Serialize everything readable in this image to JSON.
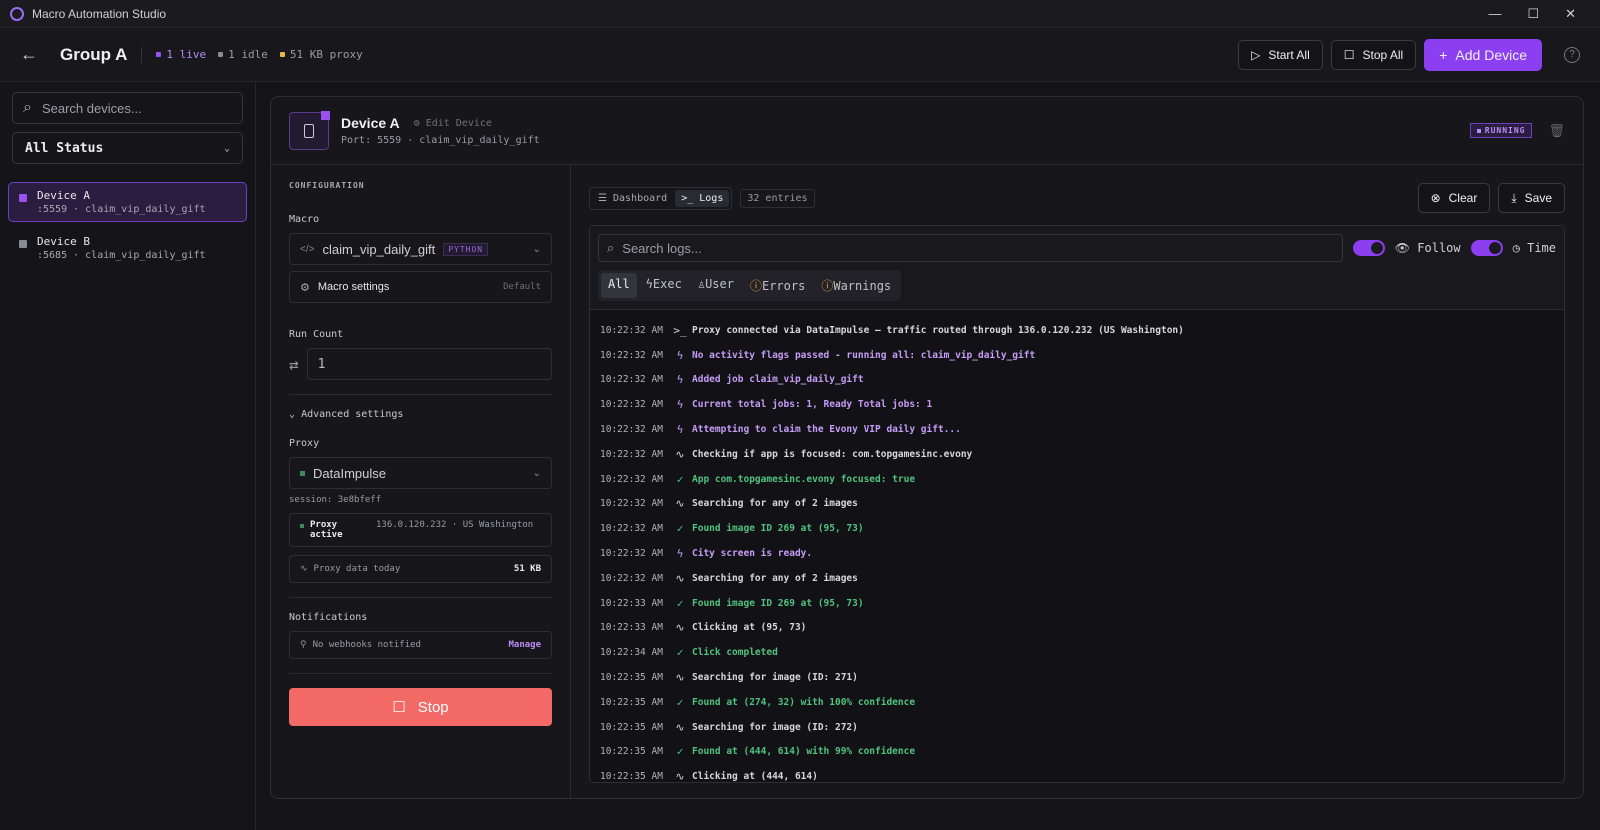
{
  "app": {
    "title": "Macro Automation Studio"
  },
  "header": {
    "group": "Group A",
    "live": "1 live",
    "idle": "1 idle",
    "proxy": "51 KB proxy",
    "start_all": "Start All",
    "stop_all": "Stop All",
    "add_device": "Add Device"
  },
  "sidebar": {
    "search_placeholder": "Search devices...",
    "status_filter": "All Status",
    "devices": [
      {
        "name": "Device A",
        "sub": ":5559 · claim_vip_daily_gift"
      },
      {
        "name": "Device B",
        "sub": ":5685 · claim_vip_daily_gift"
      }
    ]
  },
  "device": {
    "name": "Device A",
    "edit": "Edit Device",
    "sub": "Port: 5559 · claim_vip_daily_gift",
    "status": "RUNNING"
  },
  "config": {
    "section": "CONFIGURATION",
    "macro_label": "Macro",
    "macro": "claim_vip_daily_gift",
    "macro_tag": "PYTHON",
    "macro_settings": "Macro settings",
    "macro_settings_value": "Default",
    "run_count_label": "Run Count",
    "run_count": "1",
    "advanced": "Advanced settings",
    "proxy_label": "Proxy",
    "proxy": "DataImpulse",
    "session": "session: 3e8bfeff",
    "proxy_active": "Proxy active",
    "proxy_ip": "136.0.120.232 · US Washington",
    "proxy_data_label": "Proxy data today",
    "proxy_data": "51 KB",
    "notifications_label": "Notifications",
    "webhooks": "No webhooks notified",
    "manage": "Manage",
    "stop": "Stop"
  },
  "logs": {
    "tab_dashboard": "Dashboard",
    "tab_logs": "Logs",
    "entries": "32 entries",
    "clear": "Clear",
    "save": "Save",
    "search_placeholder": "Search logs...",
    "follow": "Follow",
    "time": "Time",
    "filters": [
      "All",
      "Exec",
      "User",
      "Errors",
      "Warnings"
    ],
    "rows": [
      {
        "time": "10:22:32 AM",
        "icon": "terminal-icon",
        "glyph": ">_",
        "color": "gray",
        "msg": "Proxy connected via DataImpulse — traffic routed through 136.0.120.232 (US Washington)"
      },
      {
        "time": "10:22:32 AM",
        "icon": "bolt-icon",
        "glyph": "ϟ",
        "color": "purple",
        "msg": "No activity flags passed - running all: claim_vip_daily_gift"
      },
      {
        "time": "10:22:32 AM",
        "icon": "bolt-icon",
        "glyph": "ϟ",
        "color": "purple",
        "msg": "Added job claim_vip_daily_gift"
      },
      {
        "time": "10:22:32 AM",
        "icon": "bolt-icon",
        "glyph": "ϟ",
        "color": "purple",
        "msg": "Current total jobs: 1, Ready Total jobs: 1"
      },
      {
        "time": "10:22:32 AM",
        "icon": "bolt-icon",
        "glyph": "ϟ",
        "color": "purple",
        "msg": "Attempting to claim the Evony VIP daily gift..."
      },
      {
        "time": "10:22:32 AM",
        "icon": "activity-icon",
        "glyph": "∿",
        "color": "gray",
        "msg": "Checking if app is focused: com.topgamesinc.evony"
      },
      {
        "time": "10:22:32 AM",
        "icon": "check-circle-icon",
        "glyph": "✓",
        "color": "green",
        "msg": "App com.topgamesinc.evony focused: true"
      },
      {
        "time": "10:22:32 AM",
        "icon": "activity-icon",
        "glyph": "∿",
        "color": "gray",
        "msg": "Searching for any of 2 images"
      },
      {
        "time": "10:22:32 AM",
        "icon": "check-circle-icon",
        "glyph": "✓",
        "color": "green",
        "msg": "Found image ID 269 at (95, 73)"
      },
      {
        "time": "10:22:32 AM",
        "icon": "bolt-icon",
        "glyph": "ϟ",
        "color": "purple",
        "msg": "City screen is ready."
      },
      {
        "time": "10:22:32 AM",
        "icon": "activity-icon",
        "glyph": "∿",
        "color": "gray",
        "msg": "Searching for any of 2 images"
      },
      {
        "time": "10:22:33 AM",
        "icon": "check-circle-icon",
        "glyph": "✓",
        "color": "green",
        "msg": "Found image ID 269 at (95, 73)"
      },
      {
        "time": "10:22:33 AM",
        "icon": "activity-icon",
        "glyph": "∿",
        "color": "gray",
        "msg": "Clicking at (95, 73)"
      },
      {
        "time": "10:22:34 AM",
        "icon": "check-circle-icon",
        "glyph": "✓",
        "color": "green",
        "msg": "Click completed"
      },
      {
        "time": "10:22:35 AM",
        "icon": "activity-icon",
        "glyph": "∿",
        "color": "gray",
        "msg": "Searching for image (ID: 271)"
      },
      {
        "time": "10:22:35 AM",
        "icon": "check-circle-icon",
        "glyph": "✓",
        "color": "green",
        "msg": "Found at (274, 32) with 100% confidence"
      },
      {
        "time": "10:22:35 AM",
        "icon": "activity-icon",
        "glyph": "∿",
        "color": "gray",
        "msg": "Searching for image (ID: 272)"
      },
      {
        "time": "10:22:35 AM",
        "icon": "check-circle-icon",
        "glyph": "✓",
        "color": "green",
        "msg": "Found at (444, 614) with 99% confidence"
      },
      {
        "time": "10:22:35 AM",
        "icon": "activity-icon",
        "glyph": "∿",
        "color": "gray",
        "msg": "Clicking at (444, 614)"
      }
    ]
  },
  "colors": {
    "accent": "#8b3ff0",
    "live": "#9b50f0",
    "idle": "#8a8a92",
    "proxy": "#e6b94a",
    "stop": "#f26965",
    "success": "#4fc27e"
  }
}
